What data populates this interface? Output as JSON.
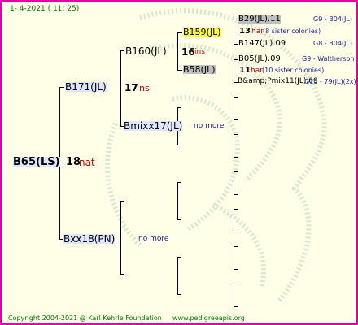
{
  "header": {
    "date": "1-  4-2021 ( 11: 25)"
  },
  "footer": {
    "copyright": "Copyright 2004-2021 @ Karl Kehrle Foundation",
    "website": "www.pedigreeapis.org"
  },
  "root": {
    "name": "B65(LS)",
    "number": "18",
    "tag": "nat"
  },
  "father": {
    "name": "B171(JL)",
    "number": "17",
    "tag": "ins"
  },
  "mother": {
    "name": "Bxx18(PN)",
    "note": "no more"
  },
  "ff": {
    "name": "B160(JL)",
    "number": "16",
    "tag": "ins"
  },
  "fm": {
    "name": "Bmixx17(JL)",
    "note": "no more"
  },
  "fff": {
    "name": "B159(JL)"
  },
  "ffm": {
    "name": "B58(JL)"
  },
  "gen5": {
    "a": {
      "name": "B29(JL).11",
      "code": "G9 - B04(JL)"
    },
    "a_number": "13",
    "a_tag": "har",
    "a_note": "(8 sister colonies)",
    "b": {
      "name": "B147(JL).09",
      "code": "G8 - B04(JL)"
    },
    "c": {
      "name": "B05(JL).09",
      "code": "G9 - Waltherson"
    },
    "c_number": "11",
    "c_tag": "har",
    "c_note": "(10 sister colonies)",
    "d": {
      "name": "B&amp;Pmix11(JL).09",
      "code": "G10 - 79(JL)(2x)"
    }
  },
  "colors": {
    "border": "#e600a0",
    "background": "#fffee6",
    "highlight_yellow": "#ffff33",
    "highlight_gray": "#bfbfbf"
  }
}
